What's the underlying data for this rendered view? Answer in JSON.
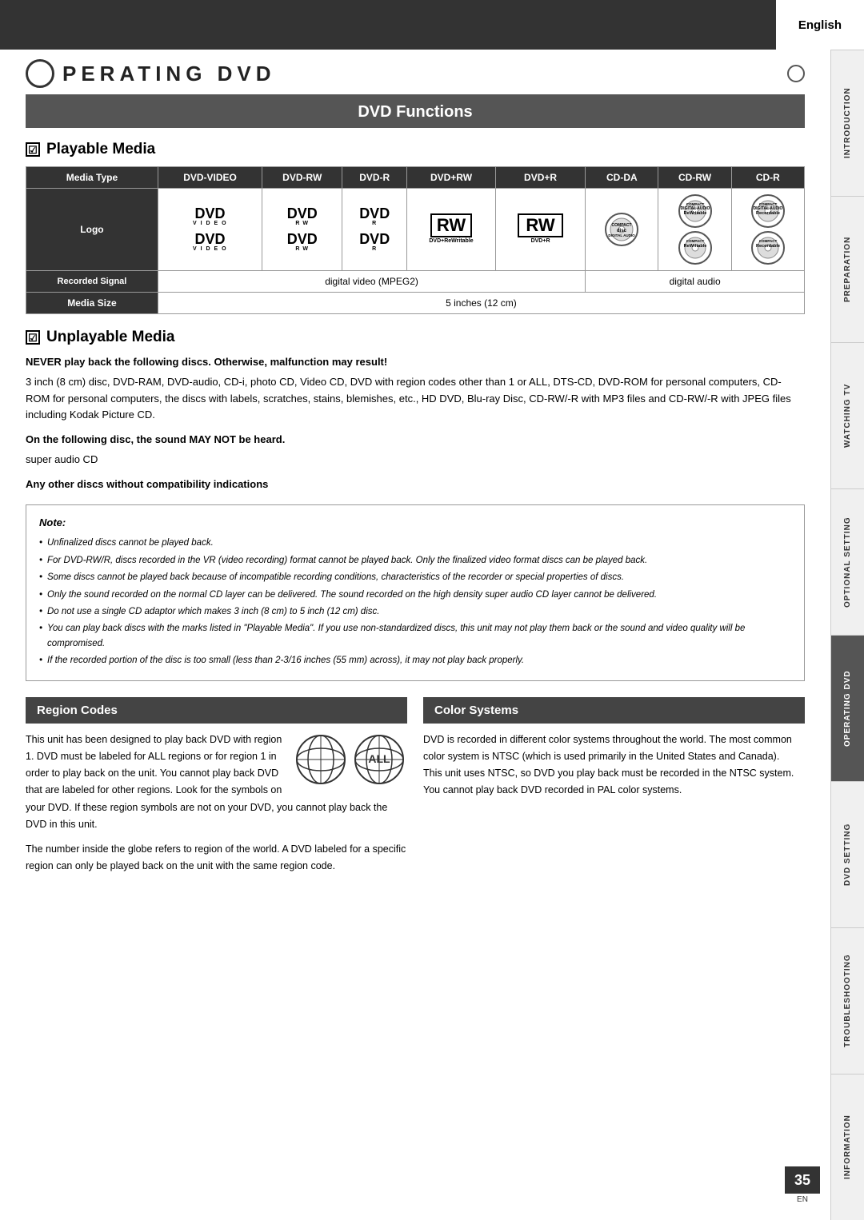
{
  "header": {
    "language": "English",
    "page_title": "PERATING   DVD"
  },
  "section_header": "DVD Functions",
  "playable_media": {
    "title": "Playable Media",
    "table": {
      "columns": [
        "Media Type",
        "DVD-VIDEO",
        "DVD-RW",
        "DVD-R",
        "DVD+RW",
        "DVD+R",
        "CD-DA",
        "CD-RW",
        "CD-R"
      ],
      "logo_row_header": "Logo",
      "recorded_signal": {
        "header": "Recorded Signal",
        "dvd_value": "digital video (MPEG2)",
        "cd_value": "digital audio"
      },
      "media_size": {
        "header": "Media Size",
        "value": "5 inches (12 cm)"
      }
    }
  },
  "unplayable_media": {
    "title": "Unplayable Media",
    "warning_bold": "NEVER play back the following discs. Otherwise, malfunction may result!",
    "warning_text": "3 inch (8 cm) disc, DVD-RAM, DVD-audio, CD-i, photo CD, Video CD, DVD with region codes other than 1 or ALL, DTS-CD, DVD-ROM for personal computers, CD-ROM for personal computers, the discs with labels, scratches, stains, blemishes, etc., HD DVD, Blu-ray Disc, CD-RW/-R with MP3 files and CD-RW/-R with JPEG files including Kodak Picture CD.",
    "sound_warning_bold": "On the following disc, the sound MAY NOT be heard.",
    "sound_warning_text": "super audio CD",
    "other_bold": "Any other discs without compatibility indications",
    "note": {
      "title": "Note:",
      "items": [
        "Unfinalized discs cannot be played back.",
        "For DVD-RW/R, discs recorded in the VR (video recording) format cannot be played back. Only the finalized video format discs can be played back.",
        "Some discs cannot be played back because of incompatible recording conditions, characteristics of the recorder or special properties of discs.",
        "Only the sound recorded on the normal CD layer can be delivered. The sound recorded on the high density super audio CD layer cannot be delivered.",
        "Do not use a single CD adaptor which makes 3 inch (8 cm) to 5 inch (12 cm) disc.",
        "You can play back discs with the marks listed in \"Playable Media\". If you use non-standardized discs, this unit may not play them back or the sound and video quality will be compromised.",
        "If the recorded portion of the disc is too small (less than 2-3/16 inches (55 mm) across), it may not play back properly."
      ]
    }
  },
  "region_codes": {
    "title": "Region Codes",
    "body": "This unit has been designed to play back DVD with region 1. DVD must be labeled for ALL regions or for region 1 in order to play back on the unit. You cannot play back DVD that are labeled for other regions. Look for the symbols on your DVD. If these region symbols are not on your DVD, you cannot play back the DVD in this unit.",
    "footer": "The number inside the globe refers to region of the world. A DVD labeled for a specific region can only be played back on the unit with the same region code."
  },
  "color_systems": {
    "title": "Color Systems",
    "body": "DVD is recorded in different color systems throughout the world. The most common color system is NTSC (which is used primarily in the United States and Canada).\nThis unit uses NTSC, so DVD you play back must be recorded in the NTSC system. You cannot play back DVD recorded in PAL color systems."
  },
  "sidebar_tabs": [
    "INTRODUCTION",
    "PREPARATION",
    "WATCHING TV",
    "OPTIONAL SETTING",
    "OPERATING DVD",
    "DVD SETTING",
    "TROUBLESHOOTING",
    "INFORMATION"
  ],
  "page_number": "35",
  "page_lang": "EN"
}
